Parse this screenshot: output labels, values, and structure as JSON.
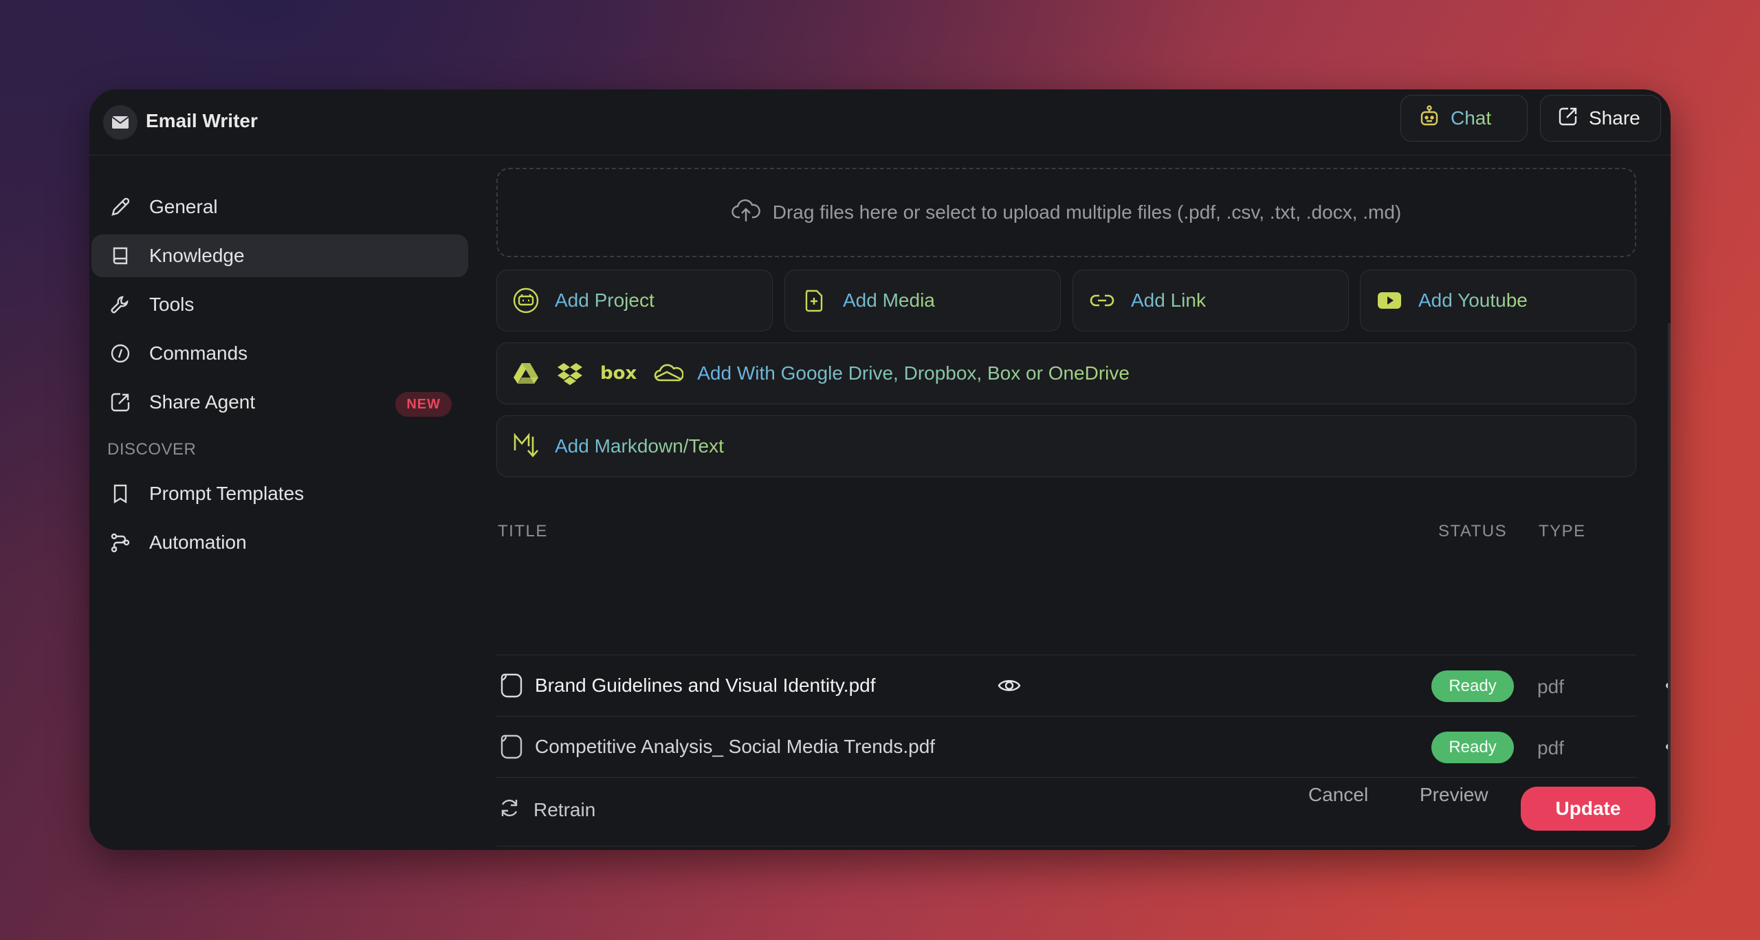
{
  "app": {
    "title": "Email Writer"
  },
  "header": {
    "chat_label": "Chat",
    "share_label": "Share"
  },
  "sidebar": {
    "items": [
      {
        "label": "General",
        "icon": "pencil-icon"
      },
      {
        "label": "Knowledge",
        "icon": "book-icon",
        "active": true
      },
      {
        "label": "Tools",
        "icon": "wrench-icon"
      },
      {
        "label": "Commands",
        "icon": "slash-command-icon"
      },
      {
        "label": "Share Agent",
        "icon": "share-icon",
        "badge": "NEW"
      }
    ],
    "section_label": "DISCOVER",
    "discover_items": [
      {
        "label": "Prompt Templates",
        "icon": "bookmark-icon"
      },
      {
        "label": "Automation",
        "icon": "automation-icon"
      }
    ]
  },
  "upload": {
    "dropzone_text": "Drag files here or select to upload multiple files (.pdf, .csv, .txt, .docx, .md)"
  },
  "sources": {
    "add_project": "Add Project",
    "add_media": "Add Media",
    "add_link": "Add Link",
    "add_youtube": "Add Youtube",
    "add_cloud": "Add With Google Drive, Dropbox, Box or OneDrive",
    "add_markdown": "Add Markdown/Text",
    "box_logo_text": "box"
  },
  "table": {
    "columns": {
      "title": "TITLE",
      "status": "STATUS",
      "type": "TYPE"
    },
    "rows": [
      {
        "title": "Brand Guidelines and Visual Identity.pdf",
        "status": "Ready",
        "type": "pdf"
      },
      {
        "title": "Competitive Analysis_ Social Media Trends.pdf",
        "status": "Ready",
        "type": "pdf"
      }
    ],
    "retrain_label": "Retrain"
  },
  "footer": {
    "cancel_label": "Cancel",
    "preview_label": "Preview",
    "update_label": "Update"
  },
  "colors": {
    "accent": "#e8405c",
    "ready": "#4fb86a",
    "gradient_start": "#63b3e8",
    "gradient_end": "#a8d67a",
    "icon_accent": "#c8d85a"
  }
}
